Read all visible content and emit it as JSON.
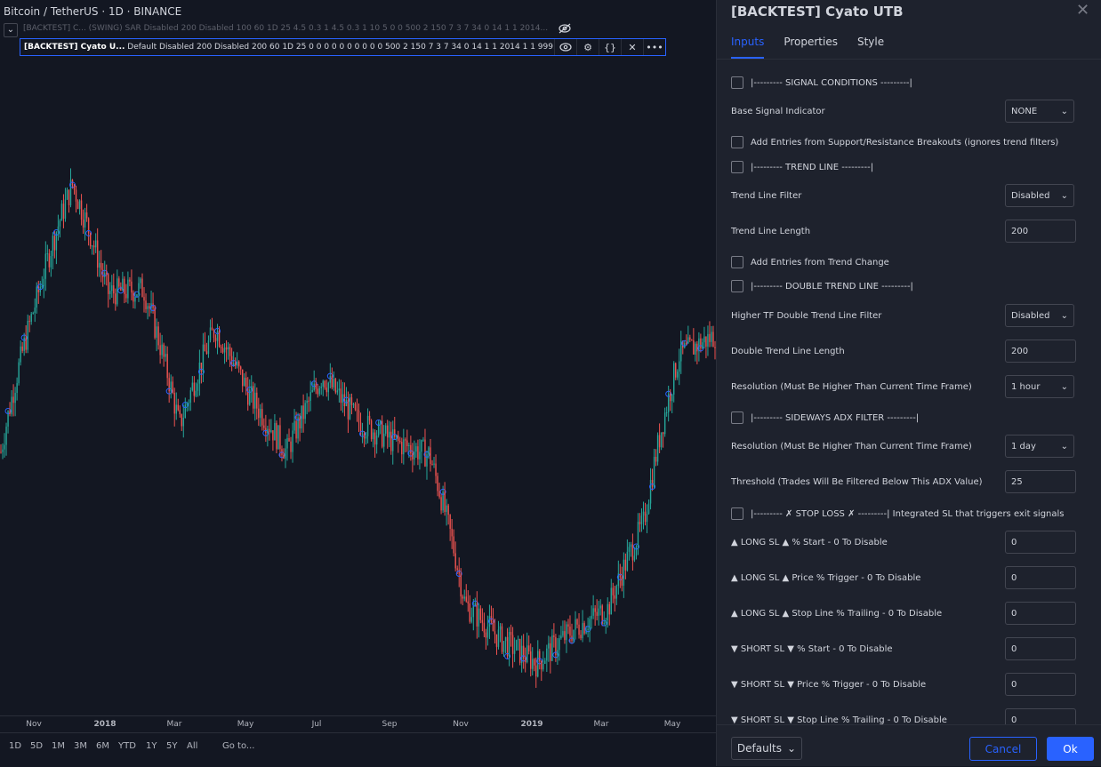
{
  "chart": {
    "symbol": "Bitcoin / TetherUS · 1D · BINANCE",
    "indicator1": "[BACKTEST] C...  (SWING) SAR Disabled 200 Disabled 100 60 1D 25 4.5 0.3 1 4.5 0.3 1 10 5 0 0 500 2 150 7 3 7 34 0 14 1 1 2014...",
    "indicator2_name": "[BACKTEST] Cyato U...",
    "indicator2_params": "Default Disabled 200 Disabled 200 60 1D 25 0 0 0 0 0 0 0 0 0 0 500 2 150 7 3 7 34 0 14 1 1 2014 1 1 999...",
    "time_labels": [
      "Nov",
      "2018",
      "Mar",
      "May",
      "Jul",
      "Sep",
      "Nov",
      "2019",
      "Mar",
      "May"
    ],
    "ranges": [
      "1D",
      "5D",
      "1M",
      "3M",
      "6M",
      "YTD",
      "1Y",
      "5Y",
      "All"
    ],
    "goto": "Go to...",
    "up_color": "#26a69a",
    "down_color": "#ef5350",
    "chart_data": {
      "type": "candlestick",
      "title": "Bitcoin / TetherUS · 1D · BINANCE",
      "x": [
        "2017-10",
        "2017-11",
        "2017-12",
        "2018-01",
        "2018-02",
        "2018-03",
        "2018-04",
        "2018-05",
        "2018-06",
        "2018-07",
        "2018-08",
        "2018-09",
        "2018-10",
        "2018-11",
        "2018-12",
        "2019-01",
        "2019-02",
        "2019-03",
        "2019-04",
        "2019-05",
        "2019-06"
      ],
      "close": [
        6400,
        10000,
        14000,
        10200,
        10300,
        6900,
        9200,
        7500,
        6400,
        8000,
        7000,
        6600,
        6350,
        4100,
        3700,
        3450,
        3800,
        4050,
        5200,
        8500,
        9000
      ],
      "ylim": [
        3000,
        20000
      ],
      "grid": false
    }
  },
  "dialog": {
    "title": "[BACKTEST] Cyato UTB",
    "tabs": [
      "Inputs",
      "Properties",
      "Style"
    ],
    "rows": {
      "signal_conditions": "|--------- SIGNAL CONDITIONS ---------|",
      "base_signal": "Base Signal Indicator",
      "base_signal_val": "NONE",
      "sr_breakouts": "Add Entries from Support/Resistance Breakouts (ignores trend filters)",
      "trend_line": "|--------- TREND LINE ---------|",
      "trend_filter": "Trend Line Filter",
      "trend_filter_val": "Disabled",
      "trend_length": "Trend Line Length",
      "trend_length_val": "200",
      "trend_change": "Add Entries from Trend Change",
      "double_trend": "|--------- DOUBLE TREND LINE ---------|",
      "htf_filter": "Higher TF Double Trend Line Filter",
      "htf_filter_val": "Disabled",
      "double_length": "Double Trend Line Length",
      "double_length_val": "200",
      "resolution1": "Resolution (Must Be Higher Than Current Time Frame)",
      "resolution1_val": "1 hour",
      "adx_filter": "|--------- SIDEWAYS ADX FILTER ---------|",
      "resolution2": "Resolution (Must Be Higher Than Current Time Frame)",
      "resolution2_val": "1 day",
      "threshold": "Threshold (Trades Will Be Filtered Below This ADX Value)",
      "threshold_val": "25",
      "stop_loss": "|--------- ✗ STOP LOSS ✗ ---------| Integrated SL that triggers exit signals",
      "long_start": "▲ LONG SL ▲ % Start - 0 To Disable",
      "long_start_val": "0",
      "long_trigger": "▲ LONG SL ▲ Price % Trigger - 0 To Disable",
      "long_trigger_val": "0",
      "long_trailing": "▲ LONG SL ▲ Stop Line % Trailing - 0 To Disable",
      "long_trailing_val": "0",
      "short_start": "▼ SHORT SL ▼ % Start - 0 To Disable",
      "short_start_val": "0",
      "short_trigger": "▼ SHORT SL ▼ Price % Trigger - 0 To Disable",
      "short_trigger_val": "0",
      "short_trailing": "▼ SHORT SL ▼ Stop Line % Trailing - 0 To Disable",
      "short_trailing_val": "0"
    },
    "footer": {
      "defaults": "Defaults",
      "cancel": "Cancel",
      "ok": "Ok"
    }
  }
}
